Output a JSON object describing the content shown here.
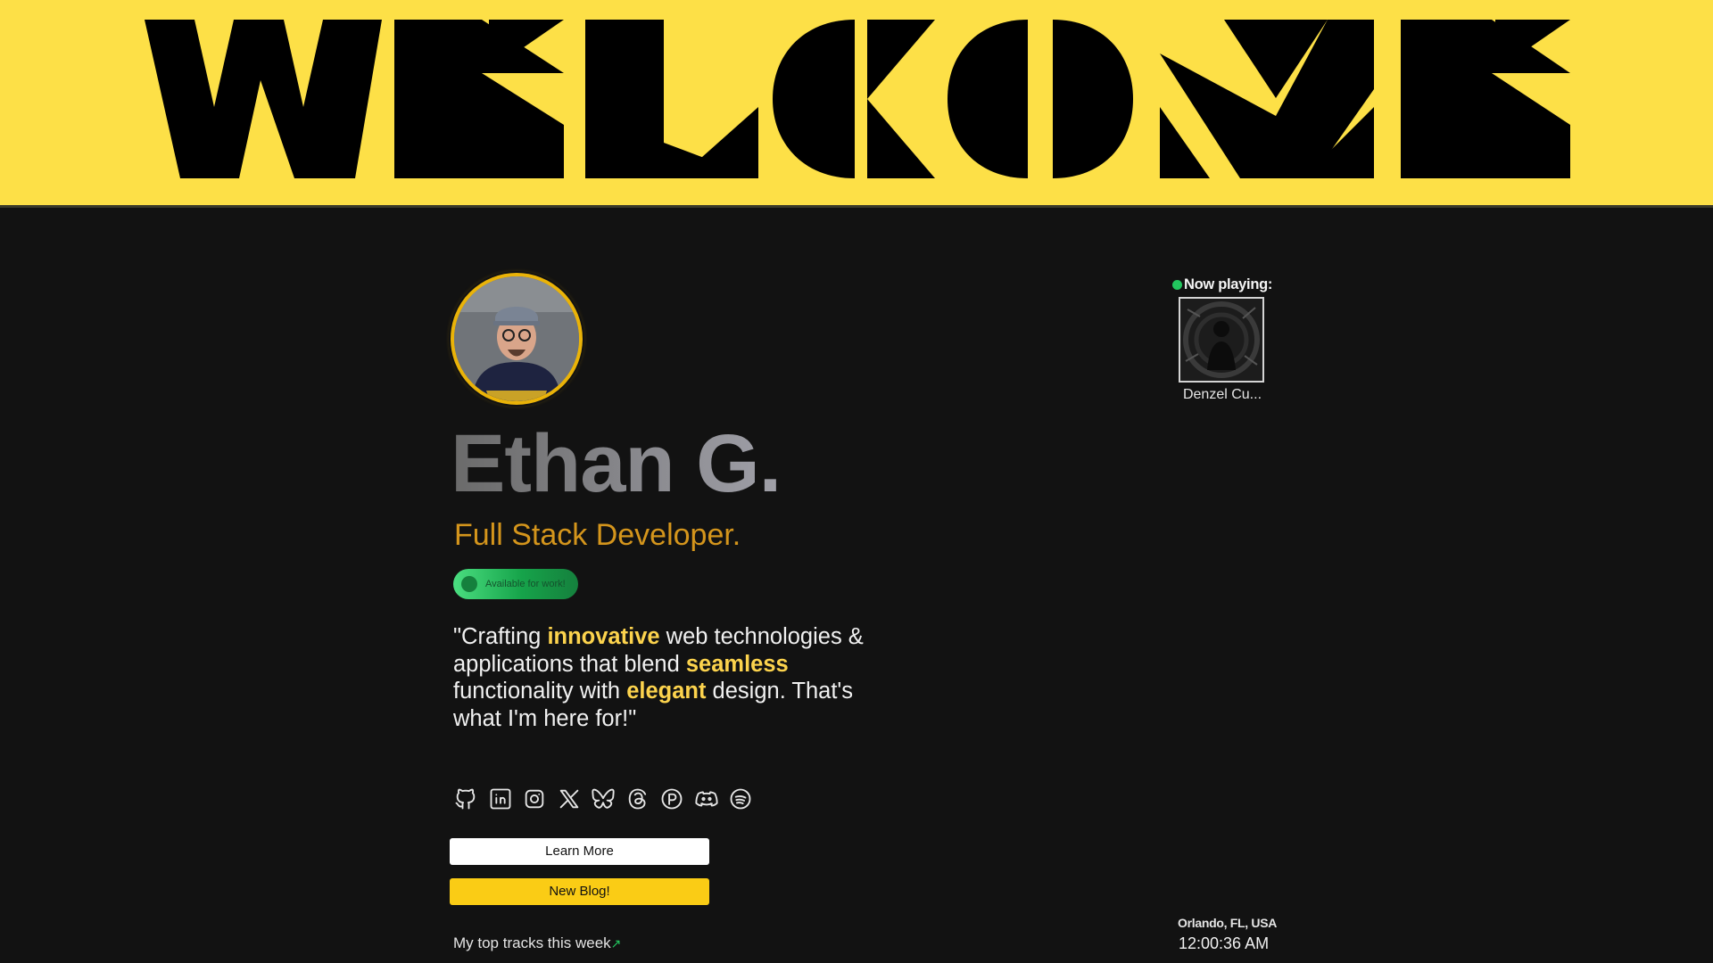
{
  "banner": {
    "text": "WELCOME",
    "bg_color": "#fde047"
  },
  "profile": {
    "name": "Ethan G.",
    "role": "Full Stack Developer.",
    "availability": "Available for work!",
    "quote": {
      "p1": "\"Crafting ",
      "h1": "innovative",
      "p2": " web technologies & applications that blend ",
      "h2": "seamless",
      "p3": " functionality with ",
      "h3": "elegant",
      "p4": " design. That's what I'm here for!\""
    }
  },
  "socials": [
    {
      "icon": "github-icon"
    },
    {
      "icon": "linkedin-icon"
    },
    {
      "icon": "instagram-icon"
    },
    {
      "icon": "x-icon"
    },
    {
      "icon": "bluesky-icon"
    },
    {
      "icon": "threads-icon"
    },
    {
      "icon": "p-icon"
    },
    {
      "icon": "discord-icon"
    },
    {
      "icon": "spotify-icon"
    }
  ],
  "buttons": {
    "learn_more": "Learn More",
    "new_blog": "New Blog!"
  },
  "top_tracks": {
    "label": "My top tracks this week",
    "arrow": "↗"
  },
  "now_playing": {
    "label": "Now playing:",
    "track": "Denzel Cu..."
  },
  "footer": {
    "location": "Orlando, FL, USA",
    "time": "12:00:36 AM"
  },
  "colors": {
    "accent": "#facc15",
    "role": "#d4951c",
    "highlight": "#fcd34d",
    "status_green": "#22c55e",
    "background": "#121212"
  }
}
